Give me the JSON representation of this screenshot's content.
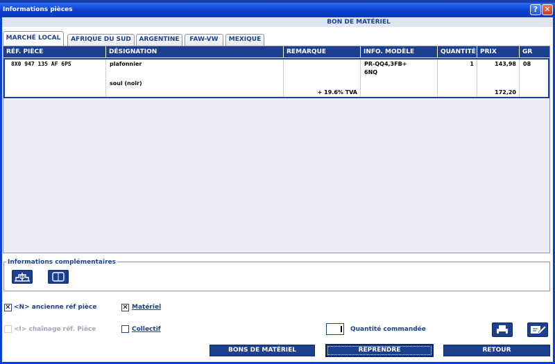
{
  "window": {
    "title": "Informations pièces",
    "help_label": "?",
    "close_label": "✕"
  },
  "section_header": "BON DE MATÉRIEL",
  "tabs": [
    {
      "label": "MARCHÉ LOCAL",
      "active": true
    },
    {
      "label": "AFRIQUE DU SUD",
      "active": false
    },
    {
      "label": "ARGENTINE",
      "active": false
    },
    {
      "label": "FAW-VW",
      "active": false
    },
    {
      "label": "MEXIQUE",
      "active": false
    }
  ],
  "table": {
    "columns": [
      "RÉF. PIÈCE",
      "DÉSIGNATION",
      "REMARQUE",
      "INFO. MODÈLE",
      "QUANTITÉ",
      "PRIX",
      "GR"
    ],
    "rows": [
      {
        "ref": "8X0 947 135 AF 6PS",
        "designation": "plafonnier",
        "designation_2": "soul (noir)",
        "remarque": "+ 19.6% TVA",
        "info_modele_1": "PR-QQ4,3FB+",
        "info_modele_2": "6NQ",
        "quantite": "1",
        "prix": "143,98",
        "prix_ttc": "172,20",
        "gr": "08"
      }
    ]
  },
  "info": {
    "legend": "Informations complémentaires",
    "buttons": [
      "tree-icon",
      "book-icon"
    ]
  },
  "options": {
    "ancienne_ref": {
      "label": "<N> ancienne réf pièce",
      "checked": true,
      "mark": "✕"
    },
    "materiel": {
      "label": "Matériel",
      "checked": true,
      "mark": "✕"
    },
    "chainage": {
      "label": "<I> chaînage réf. Pièce",
      "checked": false,
      "disabled": true
    },
    "collectif": {
      "label": "Collectif",
      "checked": false
    }
  },
  "quantite_commandee": {
    "label": "Quantité commandée"
  },
  "icons": {
    "print": "printer-icon",
    "edit": "edit-icon"
  },
  "buttons": {
    "bons": "BONS DE MATÉRIEL",
    "reprendre": "REPRENDRE",
    "retour": "RETOUR"
  },
  "colors": {
    "accent": "#1c3f8e",
    "titlebar": "#0a3fcf",
    "grid_bg": "#ececf4"
  }
}
